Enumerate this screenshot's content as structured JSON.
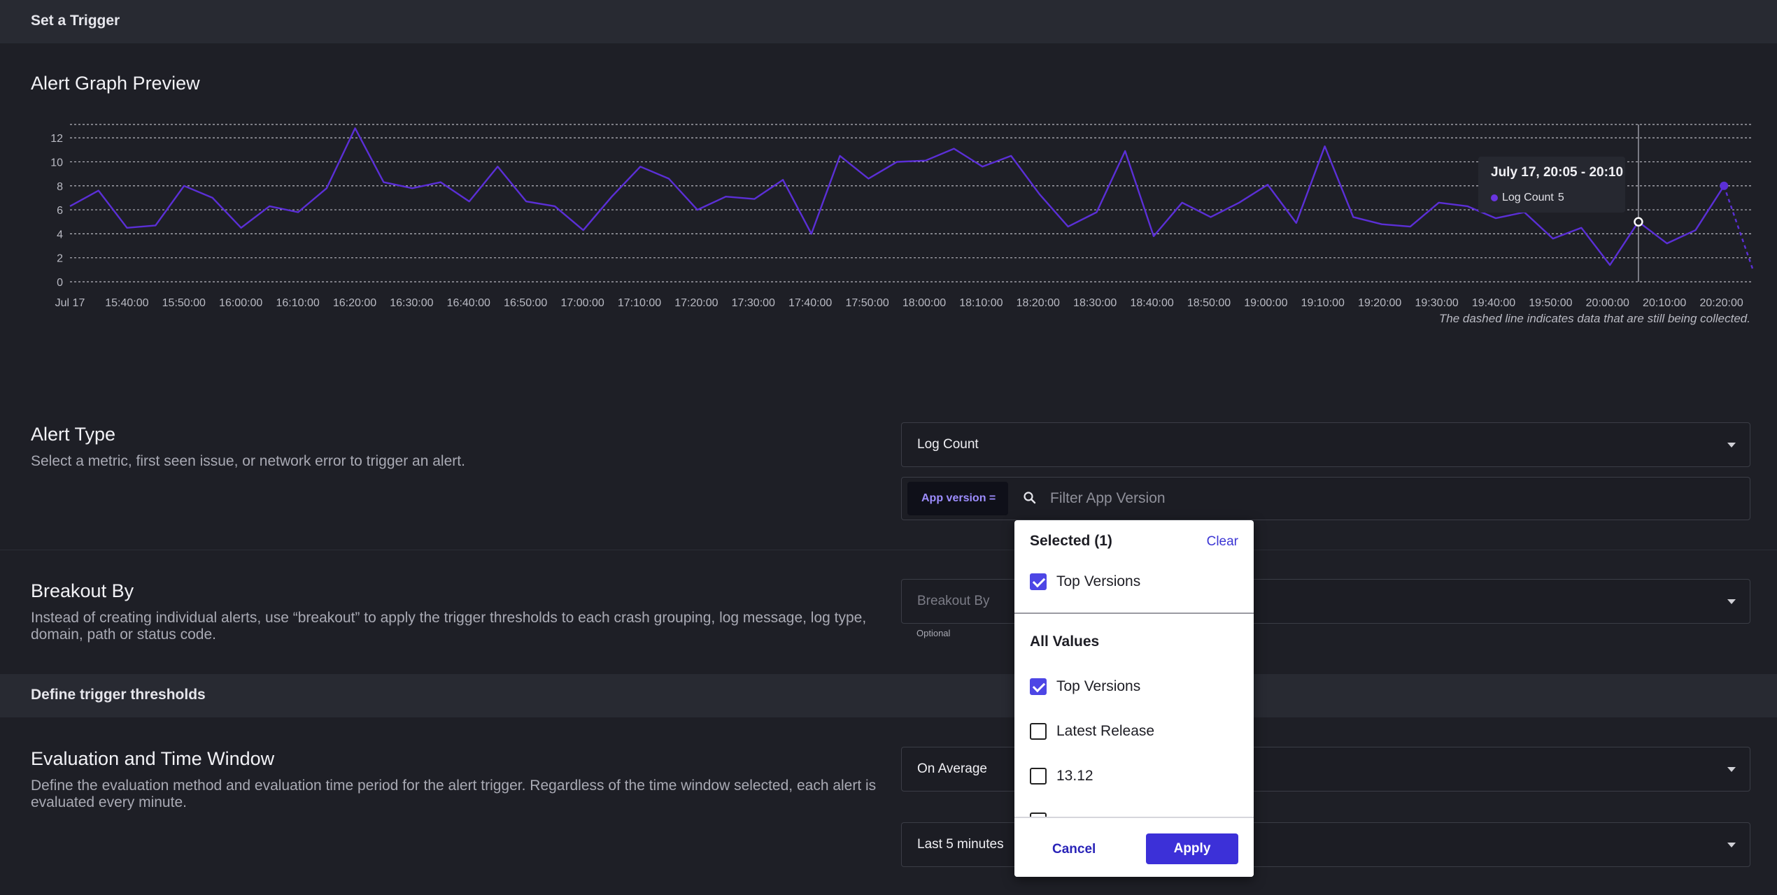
{
  "header": {
    "title": "Set a Trigger"
  },
  "preview": {
    "title": "Alert Graph Preview",
    "note": "The dashed line indicates data that are still being collected.",
    "tooltip": {
      "title": "July 17, 20:05 - 20:10",
      "series": "Log Count",
      "value": "5"
    }
  },
  "chart_data": {
    "type": "line",
    "series": [
      {
        "name": "Log Count",
        "color": "#5b2fd6"
      }
    ],
    "yticks": [
      0,
      2,
      4,
      6,
      8,
      10,
      12
    ],
    "ylim": [
      0,
      13
    ],
    "xticks": [
      "Jul 17",
      "15:40:00",
      "15:50:00",
      "16:00:00",
      "16:10:00",
      "16:20:00",
      "16:30:00",
      "16:40:00",
      "16:50:00",
      "17:00:00",
      "17:10:00",
      "17:20:00",
      "17:30:00",
      "17:40:00",
      "17:50:00",
      "18:00:00",
      "18:10:00",
      "18:20:00",
      "18:30:00",
      "18:40:00",
      "18:50:00",
      "19:00:00",
      "19:10:00",
      "19:20:00",
      "19:30:00",
      "19:40:00",
      "19:50:00",
      "20:00:00",
      "20:10:00",
      "20:20:00"
    ],
    "values": [
      6.3,
      7.6,
      4.5,
      4.7,
      8.0,
      7.0,
      4.5,
      6.3,
      5.8,
      7.8,
      12.8,
      8.3,
      7.8,
      8.3,
      6.7,
      9.6,
      6.7,
      6.3,
      4.3,
      7.1,
      9.6,
      8.6,
      6.0,
      7.1,
      6.9,
      8.5,
      4.0,
      10.5,
      8.6,
      10.0,
      10.1,
      11.1,
      9.6,
      10.5,
      7.3,
      4.6,
      5.8,
      10.9,
      3.8,
      6.6,
      5.4,
      6.6,
      8.1,
      4.9,
      11.3,
      5.4,
      4.8,
      4.6,
      6.6,
      6.3,
      5.3,
      5.8,
      3.6,
      4.5,
      1.4,
      5.0,
      3.2,
      4.3,
      8.0,
      1.1
    ],
    "dashed_from_index": 58,
    "highlight_index": 55,
    "grid": true
  },
  "alert_type": {
    "title": "Alert Type",
    "description": "Select a metric, first seen issue, or network error to trigger an alert.",
    "metric": "Log Count",
    "chip": "App version  =",
    "filter_placeholder": "Filter App Version"
  },
  "breakout": {
    "title": "Breakout By",
    "description": "Instead of creating individual alerts, use “breakout” to apply the trigger thresholds to each crash grouping, log message, log type, domain, path or status code.",
    "placeholder": "Breakout By",
    "optional": "Optional"
  },
  "thresholds": {
    "title": "Define trigger thresholds"
  },
  "evaluation": {
    "title": "Evaluation and Time Window",
    "description": "Define the evaluation method and evaluation time period for the alert trigger. Regardless of the time window selected, each alert is evaluated every minute.",
    "method": "On Average",
    "window": "Last 5 minutes"
  },
  "dropdown": {
    "selected_header": "Selected (1)",
    "clear": "Clear",
    "selected_items": [
      {
        "label": "Top Versions",
        "checked": true
      }
    ],
    "all_header": "All Values",
    "all_items": [
      {
        "label": "Top Versions",
        "checked": true
      },
      {
        "label": "Latest Release",
        "checked": false
      },
      {
        "label": "13.12",
        "checked": false
      }
    ],
    "cancel": "Cancel",
    "apply": "Apply"
  }
}
